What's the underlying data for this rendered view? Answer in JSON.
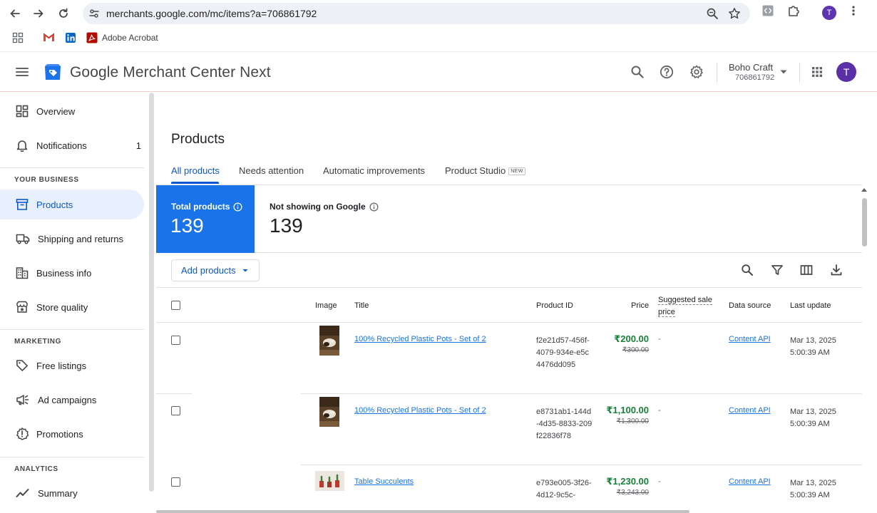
{
  "browser": {
    "url": "merchants.google.com/mc/items?a=706861792",
    "profile_initial": "T",
    "bookmarks": [
      {
        "label": "",
        "icon": "apps-grid-icon"
      },
      {
        "label": "",
        "icon": "gmail-icon"
      },
      {
        "label": "",
        "icon": "linkedin-icon"
      },
      {
        "label": "Adobe Acrobat",
        "icon": "acrobat-icon"
      }
    ]
  },
  "header": {
    "title_brand": "Google",
    "title_product": "Merchant Center Next",
    "account_name": "Boho Craft",
    "account_id": "706861792",
    "avatar_initial": "T"
  },
  "sidebar": {
    "items": [
      {
        "label": "Overview",
        "icon": "overview-icon"
      },
      {
        "label": "Notifications",
        "icon": "bell-icon",
        "count": "1"
      }
    ],
    "section_business": "YOUR BUSINESS",
    "business_items": [
      {
        "label": "Products",
        "icon": "products-icon",
        "active": true
      },
      {
        "label": "Shipping and returns",
        "icon": "truck-icon"
      },
      {
        "label": "Business info",
        "icon": "building-icon"
      },
      {
        "label": "Store quality",
        "icon": "store-quality-icon"
      }
    ],
    "section_marketing": "MARKETING",
    "marketing_items": [
      {
        "label": "Free listings",
        "icon": "tag-icon"
      },
      {
        "label": "Ad campaigns",
        "icon": "megaphone-icon"
      },
      {
        "label": "Promotions",
        "icon": "promotions-icon"
      }
    ],
    "section_analytics": "ANALYTICS",
    "analytics_items": [
      {
        "label": "Summary",
        "icon": "trend-icon"
      }
    ]
  },
  "main": {
    "page_title": "Products",
    "tabs": [
      {
        "label": "All products",
        "active": true
      },
      {
        "label": "Needs attention"
      },
      {
        "label": "Automatic improvements"
      },
      {
        "label": "Product Studio",
        "badge": "NEW"
      }
    ],
    "stats": {
      "total_label": "Total products",
      "total_value": "139",
      "not_showing_label": "Not showing on Google",
      "not_showing_value": "139"
    },
    "add_products_label": "Add products",
    "columns": {
      "image": "Image",
      "title": "Title",
      "product_id": "Product ID",
      "price": "Price",
      "suggested_line1": "Suggested sale",
      "suggested_line2": "price",
      "data_source": "Data source",
      "last_update": "Last update"
    },
    "rows": [
      {
        "title": "100% Recycled Plastic Pots - Set of 2",
        "product_id": "f2e21d57-456f-4079-934e-e5c4476dd095",
        "price": "₹200.00",
        "price_old": "₹300.00",
        "suggested": "-",
        "data_source": "Content API",
        "last_update_date": "Mar 13, 2025",
        "last_update_time": "5:00:39 AM"
      },
      {
        "title": "100% Recycled Plastic Pots - Set of 2",
        "product_id": "e8731ab1-144d-4d35-8833-209f22836f78",
        "price": "₹1,100.00",
        "price_old": "₹1,300.00",
        "suggested": "-",
        "data_source": "Content API",
        "last_update_date": "Mar 13, 2025",
        "last_update_time": "5:00:39 AM"
      },
      {
        "title": "Table Succulents",
        "product_id": "e793e005-3f26-4d12-9c5c-",
        "price": "₹1,230.00",
        "price_old": "₹3,243.00",
        "suggested": "-",
        "data_source": "Content API",
        "last_update_date": "Mar 13, 2025",
        "last_update_time": "5:00:39 AM"
      }
    ]
  }
}
